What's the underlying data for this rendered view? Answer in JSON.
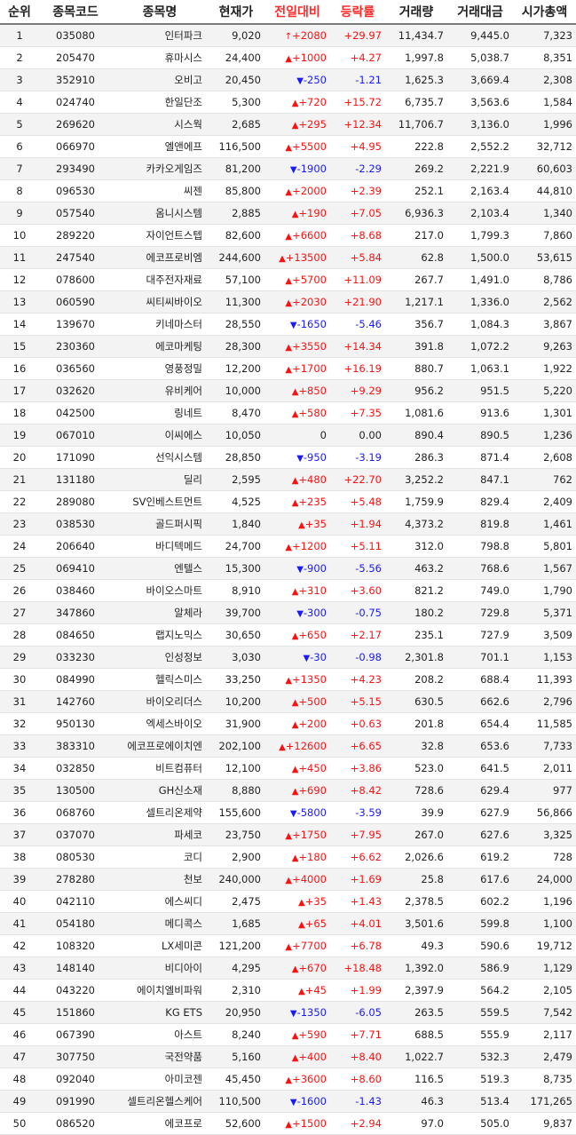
{
  "table": {
    "headers": [
      {
        "key": "rank",
        "label": "순위",
        "highlight": false
      },
      {
        "key": "code",
        "label": "종목코드",
        "highlight": false
      },
      {
        "key": "name",
        "label": "종목명",
        "highlight": false
      },
      {
        "key": "price",
        "label": "현재가",
        "highlight": false
      },
      {
        "key": "change",
        "label": "전일대비",
        "highlight": true
      },
      {
        "key": "rate",
        "label": "등락률",
        "highlight": true
      },
      {
        "key": "volume",
        "label": "거래량",
        "highlight": false
      },
      {
        "key": "amount",
        "label": "거래대금",
        "highlight": false
      },
      {
        "key": "market_cap",
        "label": "시가총액",
        "highlight": false
      }
    ],
    "colors": {
      "up": "#ff1010",
      "down": "#1a1aff",
      "flat": "#222222",
      "header_highlight": "#ff2a2a"
    },
    "rows": [
      {
        "rank": "1",
        "code": "035080",
        "name": "인터파크",
        "price": "9,020",
        "dir": "limit-up",
        "change": "+2080",
        "rate": "+29.97",
        "volume": "11,434.7",
        "amount": "9,445.0",
        "market_cap": "7,323"
      },
      {
        "rank": "2",
        "code": "205470",
        "name": "휴마시스",
        "price": "24,400",
        "dir": "up",
        "change": "+1000",
        "rate": "+4.27",
        "volume": "1,997.8",
        "amount": "5,038.7",
        "market_cap": "8,351"
      },
      {
        "rank": "3",
        "code": "352910",
        "name": "오비고",
        "price": "20,450",
        "dir": "down",
        "change": "-250",
        "rate": "-1.21",
        "volume": "1,625.3",
        "amount": "3,669.4",
        "market_cap": "2,308"
      },
      {
        "rank": "4",
        "code": "024740",
        "name": "한일단조",
        "price": "5,300",
        "dir": "up",
        "change": "+720",
        "rate": "+15.72",
        "volume": "6,735.7",
        "amount": "3,563.6",
        "market_cap": "1,584"
      },
      {
        "rank": "5",
        "code": "269620",
        "name": "시스웍",
        "price": "2,685",
        "dir": "up",
        "change": "+295",
        "rate": "+12.34",
        "volume": "11,706.7",
        "amount": "3,136.0",
        "market_cap": "1,996"
      },
      {
        "rank": "6",
        "code": "066970",
        "name": "엘앤에프",
        "price": "116,500",
        "dir": "up",
        "change": "+5500",
        "rate": "+4.95",
        "volume": "222.8",
        "amount": "2,552.2",
        "market_cap": "32,712"
      },
      {
        "rank": "7",
        "code": "293490",
        "name": "카카오게임즈",
        "price": "81,200",
        "dir": "down",
        "change": "-1900",
        "rate": "-2.29",
        "volume": "269.2",
        "amount": "2,221.9",
        "market_cap": "60,603"
      },
      {
        "rank": "8",
        "code": "096530",
        "name": "씨젠",
        "price": "85,800",
        "dir": "up",
        "change": "+2000",
        "rate": "+2.39",
        "volume": "252.1",
        "amount": "2,163.4",
        "market_cap": "44,810"
      },
      {
        "rank": "9",
        "code": "057540",
        "name": "옴니시스템",
        "price": "2,885",
        "dir": "up",
        "change": "+190",
        "rate": "+7.05",
        "volume": "6,936.3",
        "amount": "2,103.4",
        "market_cap": "1,340"
      },
      {
        "rank": "10",
        "code": "289220",
        "name": "자이언트스텝",
        "price": "82,600",
        "dir": "up",
        "change": "+6600",
        "rate": "+8.68",
        "volume": "217.0",
        "amount": "1,799.3",
        "market_cap": "7,860"
      },
      {
        "rank": "11",
        "code": "247540",
        "name": "에코프로비엠",
        "price": "244,600",
        "dir": "up",
        "change": "+13500",
        "rate": "+5.84",
        "volume": "62.8",
        "amount": "1,500.0",
        "market_cap": "53,615"
      },
      {
        "rank": "12",
        "code": "078600",
        "name": "대주전자재료",
        "price": "57,100",
        "dir": "up",
        "change": "+5700",
        "rate": "+11.09",
        "volume": "267.7",
        "amount": "1,491.0",
        "market_cap": "8,786"
      },
      {
        "rank": "13",
        "code": "060590",
        "name": "씨티씨바이오",
        "price": "11,300",
        "dir": "up",
        "change": "+2030",
        "rate": "+21.90",
        "volume": "1,217.1",
        "amount": "1,336.0",
        "market_cap": "2,562"
      },
      {
        "rank": "14",
        "code": "139670",
        "name": "키네마스터",
        "price": "28,550",
        "dir": "down",
        "change": "-1650",
        "rate": "-5.46",
        "volume": "356.7",
        "amount": "1,084.3",
        "market_cap": "3,867"
      },
      {
        "rank": "15",
        "code": "230360",
        "name": "에코마케팅",
        "price": "28,300",
        "dir": "up",
        "change": "+3550",
        "rate": "+14.34",
        "volume": "391.8",
        "amount": "1,072.2",
        "market_cap": "9,263"
      },
      {
        "rank": "16",
        "code": "036560",
        "name": "영풍정밀",
        "price": "12,200",
        "dir": "up",
        "change": "+1700",
        "rate": "+16.19",
        "volume": "880.7",
        "amount": "1,063.1",
        "market_cap": "1,922"
      },
      {
        "rank": "17",
        "code": "032620",
        "name": "유비케어",
        "price": "10,000",
        "dir": "up",
        "change": "+850",
        "rate": "+9.29",
        "volume": "956.2",
        "amount": "951.5",
        "market_cap": "5,220"
      },
      {
        "rank": "18",
        "code": "042500",
        "name": "링네트",
        "price": "8,470",
        "dir": "up",
        "change": "+580",
        "rate": "+7.35",
        "volume": "1,081.6",
        "amount": "913.6",
        "market_cap": "1,301"
      },
      {
        "rank": "19",
        "code": "067010",
        "name": "이씨에스",
        "price": "10,050",
        "dir": "flat",
        "change": "0",
        "rate": "0.00",
        "volume": "890.4",
        "amount": "890.5",
        "market_cap": "1,236"
      },
      {
        "rank": "20",
        "code": "171090",
        "name": "선익시스템",
        "price": "28,850",
        "dir": "down",
        "change": "-950",
        "rate": "-3.19",
        "volume": "286.3",
        "amount": "871.4",
        "market_cap": "2,608"
      },
      {
        "rank": "21",
        "code": "131180",
        "name": "딜리",
        "price": "2,595",
        "dir": "up",
        "change": "+480",
        "rate": "+22.70",
        "volume": "3,252.2",
        "amount": "847.1",
        "market_cap": "762"
      },
      {
        "rank": "22",
        "code": "289080",
        "name": "SV인베스트먼트",
        "price": "4,525",
        "dir": "up",
        "change": "+235",
        "rate": "+5.48",
        "volume": "1,759.9",
        "amount": "829.4",
        "market_cap": "2,409"
      },
      {
        "rank": "23",
        "code": "038530",
        "name": "골드퍼시픽",
        "price": "1,840",
        "dir": "up",
        "change": "+35",
        "rate": "+1.94",
        "volume": "4,373.2",
        "amount": "819.8",
        "market_cap": "1,461"
      },
      {
        "rank": "24",
        "code": "206640",
        "name": "바디텍메드",
        "price": "24,700",
        "dir": "up",
        "change": "+1200",
        "rate": "+5.11",
        "volume": "312.0",
        "amount": "798.8",
        "market_cap": "5,801"
      },
      {
        "rank": "25",
        "code": "069410",
        "name": "엔텔스",
        "price": "15,300",
        "dir": "down",
        "change": "-900",
        "rate": "-5.56",
        "volume": "463.2",
        "amount": "768.6",
        "market_cap": "1,567"
      },
      {
        "rank": "26",
        "code": "038460",
        "name": "바이오스마트",
        "price": "8,910",
        "dir": "up",
        "change": "+310",
        "rate": "+3.60",
        "volume": "821.2",
        "amount": "749.0",
        "market_cap": "1,790"
      },
      {
        "rank": "27",
        "code": "347860",
        "name": "알체라",
        "price": "39,700",
        "dir": "down",
        "change": "-300",
        "rate": "-0.75",
        "volume": "180.2",
        "amount": "729.8",
        "market_cap": "5,371"
      },
      {
        "rank": "28",
        "code": "084650",
        "name": "랩지노믹스",
        "price": "30,650",
        "dir": "up",
        "change": "+650",
        "rate": "+2.17",
        "volume": "235.1",
        "amount": "727.9",
        "market_cap": "3,509"
      },
      {
        "rank": "29",
        "code": "033230",
        "name": "인성정보",
        "price": "3,030",
        "dir": "down",
        "change": "-30",
        "rate": "-0.98",
        "volume": "2,301.8",
        "amount": "701.1",
        "market_cap": "1,153"
      },
      {
        "rank": "30",
        "code": "084990",
        "name": "헬릭스미스",
        "price": "33,250",
        "dir": "up",
        "change": "+1350",
        "rate": "+4.23",
        "volume": "208.2",
        "amount": "688.4",
        "market_cap": "11,393"
      },
      {
        "rank": "31",
        "code": "142760",
        "name": "바이오리더스",
        "price": "10,200",
        "dir": "up",
        "change": "+500",
        "rate": "+5.15",
        "volume": "630.5",
        "amount": "662.6",
        "market_cap": "2,796"
      },
      {
        "rank": "32",
        "code": "950130",
        "name": "엑세스바이오",
        "price": "31,900",
        "dir": "up",
        "change": "+200",
        "rate": "+0.63",
        "volume": "201.8",
        "amount": "654.4",
        "market_cap": "11,585"
      },
      {
        "rank": "33",
        "code": "383310",
        "name": "에코프로에이치엔",
        "price": "202,100",
        "dir": "up",
        "change": "+12600",
        "rate": "+6.65",
        "volume": "32.8",
        "amount": "653.6",
        "market_cap": "7,733"
      },
      {
        "rank": "34",
        "code": "032850",
        "name": "비트컴퓨터",
        "price": "12,100",
        "dir": "up",
        "change": "+450",
        "rate": "+3.86",
        "volume": "523.0",
        "amount": "641.5",
        "market_cap": "2,011"
      },
      {
        "rank": "35",
        "code": "130500",
        "name": "GH신소재",
        "price": "8,880",
        "dir": "up",
        "change": "+690",
        "rate": "+8.42",
        "volume": "728.6",
        "amount": "629.4",
        "market_cap": "977"
      },
      {
        "rank": "36",
        "code": "068760",
        "name": "셀트리온제약",
        "price": "155,600",
        "dir": "down",
        "change": "-5800",
        "rate": "-3.59",
        "volume": "39.9",
        "amount": "627.9",
        "market_cap": "56,866"
      },
      {
        "rank": "37",
        "code": "037070",
        "name": "파세코",
        "price": "23,750",
        "dir": "up",
        "change": "+1750",
        "rate": "+7.95",
        "volume": "267.0",
        "amount": "627.6",
        "market_cap": "3,325"
      },
      {
        "rank": "38",
        "code": "080530",
        "name": "코디",
        "price": "2,900",
        "dir": "up",
        "change": "+180",
        "rate": "+6.62",
        "volume": "2,026.6",
        "amount": "619.2",
        "market_cap": "728"
      },
      {
        "rank": "39",
        "code": "278280",
        "name": "천보",
        "price": "240,000",
        "dir": "up",
        "change": "+4000",
        "rate": "+1.69",
        "volume": "25.8",
        "amount": "617.6",
        "market_cap": "24,000"
      },
      {
        "rank": "40",
        "code": "042110",
        "name": "에스씨디",
        "price": "2,475",
        "dir": "up",
        "change": "+35",
        "rate": "+1.43",
        "volume": "2,378.5",
        "amount": "602.2",
        "market_cap": "1,196"
      },
      {
        "rank": "41",
        "code": "054180",
        "name": "메디콕스",
        "price": "1,685",
        "dir": "up",
        "change": "+65",
        "rate": "+4.01",
        "volume": "3,501.6",
        "amount": "599.8",
        "market_cap": "1,100"
      },
      {
        "rank": "42",
        "code": "108320",
        "name": "LX세미콘",
        "price": "121,200",
        "dir": "up",
        "change": "+7700",
        "rate": "+6.78",
        "volume": "49.3",
        "amount": "590.6",
        "market_cap": "19,712"
      },
      {
        "rank": "43",
        "code": "148140",
        "name": "비디아이",
        "price": "4,295",
        "dir": "up",
        "change": "+670",
        "rate": "+18.48",
        "volume": "1,392.0",
        "amount": "586.9",
        "market_cap": "1,129"
      },
      {
        "rank": "44",
        "code": "043220",
        "name": "에이치엘비파워",
        "price": "2,310",
        "dir": "up",
        "change": "+45",
        "rate": "+1.99",
        "volume": "2,397.9",
        "amount": "564.2",
        "market_cap": "2,105"
      },
      {
        "rank": "45",
        "code": "151860",
        "name": "KG ETS",
        "price": "20,950",
        "dir": "down",
        "change": "-1350",
        "rate": "-6.05",
        "volume": "263.5",
        "amount": "559.5",
        "market_cap": "7,542"
      },
      {
        "rank": "46",
        "code": "067390",
        "name": "아스트",
        "price": "8,240",
        "dir": "up",
        "change": "+590",
        "rate": "+7.71",
        "volume": "688.5",
        "amount": "555.9",
        "market_cap": "2,117"
      },
      {
        "rank": "47",
        "code": "307750",
        "name": "국전약품",
        "price": "5,160",
        "dir": "up",
        "change": "+400",
        "rate": "+8.40",
        "volume": "1,022.7",
        "amount": "532.3",
        "market_cap": "2,479"
      },
      {
        "rank": "48",
        "code": "092040",
        "name": "아미코젠",
        "price": "45,450",
        "dir": "up",
        "change": "+3600",
        "rate": "+8.60",
        "volume": "116.5",
        "amount": "519.3",
        "market_cap": "8,735"
      },
      {
        "rank": "49",
        "code": "091990",
        "name": "셀트리온헬스케어",
        "price": "110,500",
        "dir": "down",
        "change": "-1600",
        "rate": "-1.43",
        "volume": "46.3",
        "amount": "513.4",
        "market_cap": "171,265"
      },
      {
        "rank": "50",
        "code": "086520",
        "name": "에코프로",
        "price": "52,600",
        "dir": "up",
        "change": "+1500",
        "rate": "+2.94",
        "volume": "97.0",
        "amount": "505.0",
        "market_cap": "9,837"
      }
    ]
  }
}
